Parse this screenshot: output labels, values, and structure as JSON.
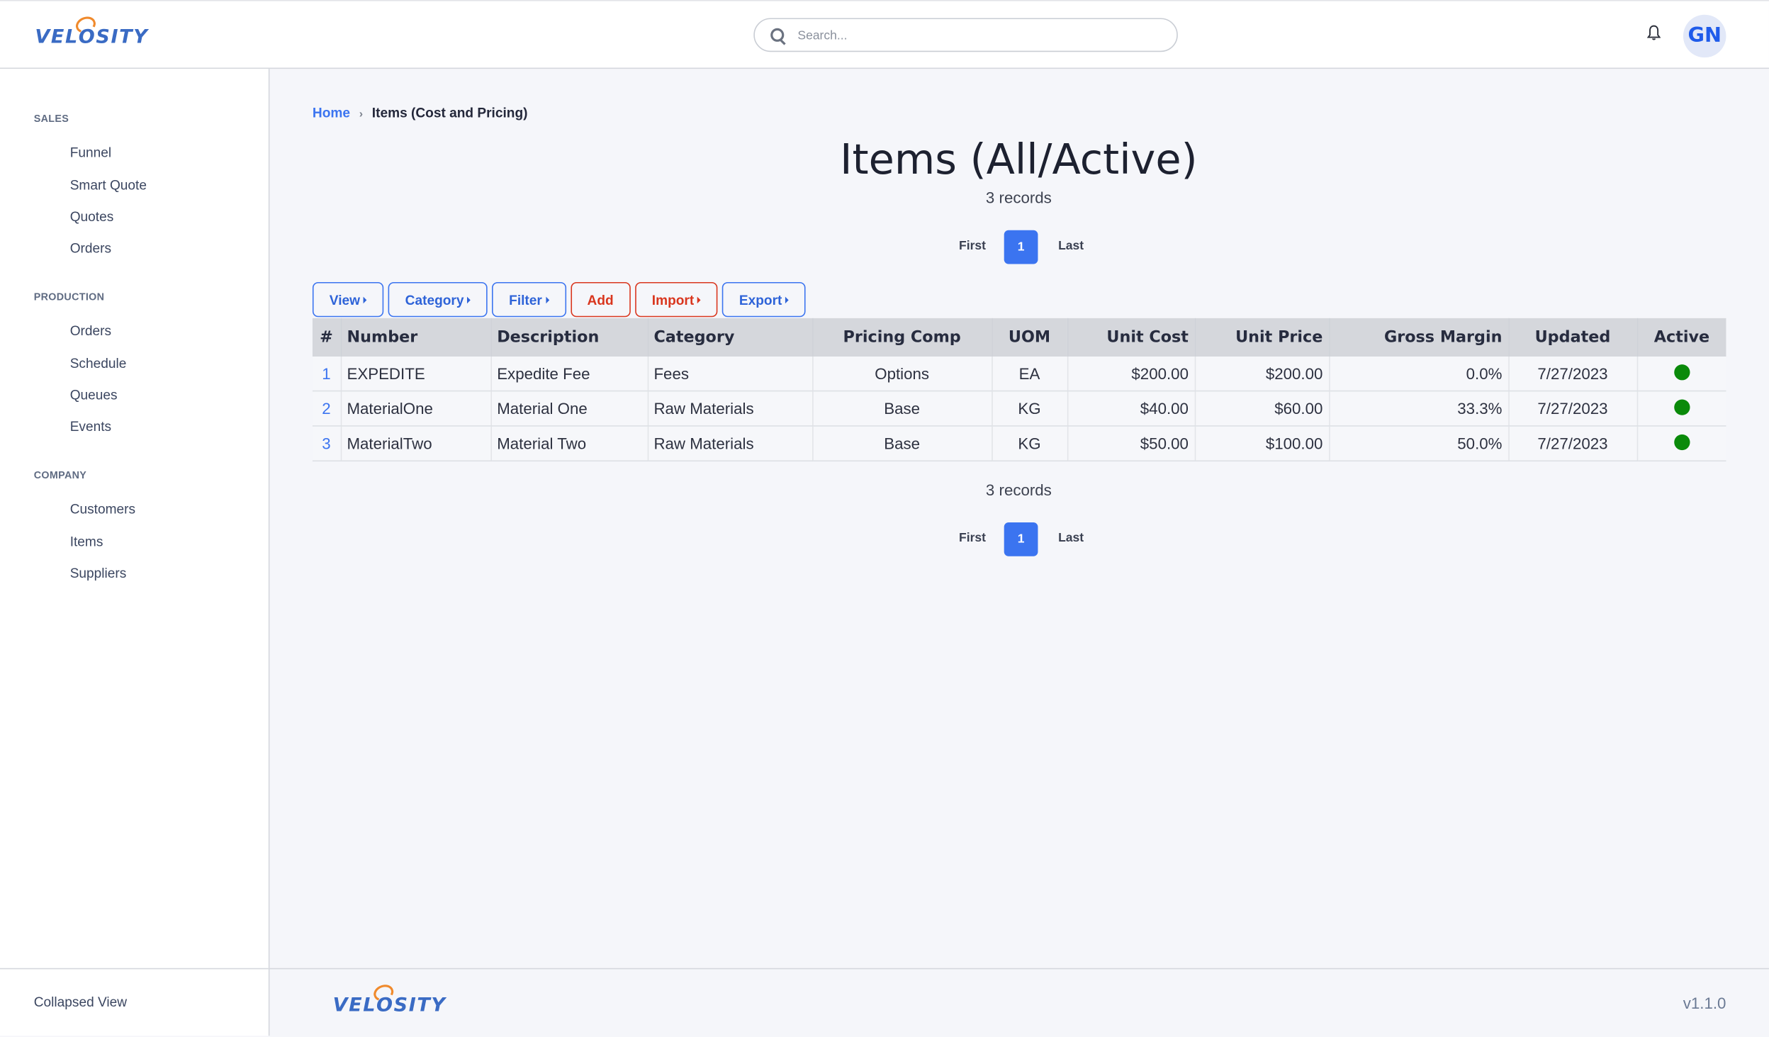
{
  "header": {
    "logo_text": [
      "VEL",
      "O",
      "SITY"
    ],
    "search_placeholder": "Search...",
    "search_value": "",
    "avatar_initials": "GN"
  },
  "sidebar": {
    "sections": [
      {
        "label": "SALES",
        "items": [
          "Funnel",
          "Smart Quote",
          "Quotes",
          "Orders"
        ]
      },
      {
        "label": "PRODUCTION",
        "items": [
          "Orders",
          "Schedule",
          "Queues",
          "Events"
        ]
      },
      {
        "label": "COMPANY",
        "items": [
          "Customers",
          "Items",
          "Suppliers"
        ]
      }
    ],
    "footer_label": "Collapsed View"
  },
  "breadcrumb": {
    "home": "Home",
    "separator": "›",
    "current": "Items (Cost and Pricing)"
  },
  "page": {
    "title": "Items (All/Active)",
    "record_count": "3 records",
    "pagination": {
      "first": "First",
      "current": "1",
      "last": "Last"
    }
  },
  "toolbar": [
    {
      "label": "View",
      "caret": true,
      "style": "primary"
    },
    {
      "label": "Category",
      "caret": true,
      "style": "primary"
    },
    {
      "label": "Filter",
      "caret": true,
      "style": "primary"
    },
    {
      "label": "Add",
      "caret": false,
      "style": "danger"
    },
    {
      "label": "Import",
      "caret": true,
      "style": "danger"
    },
    {
      "label": "Export",
      "caret": true,
      "style": "primary"
    }
  ],
  "table": {
    "columns": [
      "#",
      "Number",
      "Description",
      "Category",
      "Pricing Comp",
      "UOM",
      "Unit Cost",
      "Unit Price",
      "Gross Margin",
      "Updated",
      "Active"
    ],
    "rows": [
      [
        "1",
        "EXPEDITE",
        "Expedite Fee",
        "Fees",
        "Options",
        "EA",
        "$200.00",
        "$200.00",
        "0.0%",
        "7/27/2023",
        "active"
      ],
      [
        "2",
        "MaterialOne",
        "Material One",
        "Raw Materials",
        "Base",
        "KG",
        "$40.00",
        "$60.00",
        "33.3%",
        "7/27/2023",
        "active"
      ],
      [
        "3",
        "MaterialTwo",
        "Material Two",
        "Raw Materials",
        "Base",
        "KG",
        "$50.00",
        "$100.00",
        "50.0%",
        "7/27/2023",
        "active"
      ]
    ]
  },
  "colors": {
    "accent": "#3b74f0",
    "danger": "#d9361e",
    "active_status": "#0a8a0a",
    "brand_orange": "#f08a2c"
  },
  "footer": {
    "version": "v1.1.0"
  }
}
